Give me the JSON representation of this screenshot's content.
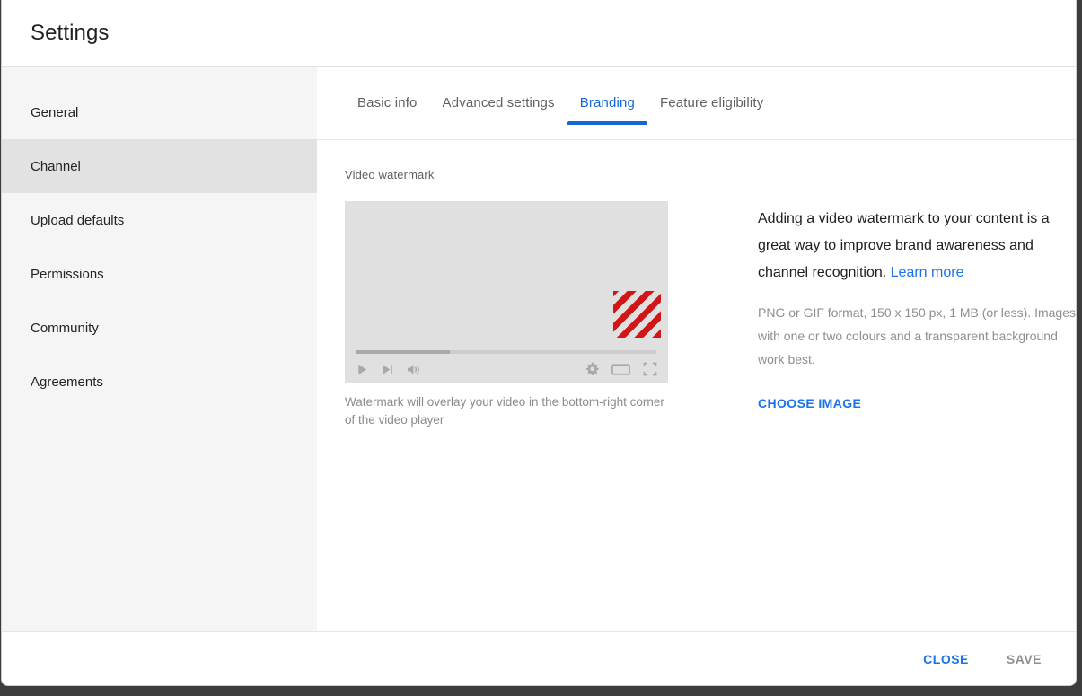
{
  "dialog": {
    "title": "Settings"
  },
  "sidebar": {
    "items": [
      {
        "label": "General",
        "selected": false
      },
      {
        "label": "Channel",
        "selected": true
      },
      {
        "label": "Upload defaults",
        "selected": false
      },
      {
        "label": "Permissions",
        "selected": false
      },
      {
        "label": "Community",
        "selected": false
      },
      {
        "label": "Agreements",
        "selected": false
      }
    ]
  },
  "tabs": [
    {
      "label": "Basic info",
      "active": false
    },
    {
      "label": "Advanced settings",
      "active": false
    },
    {
      "label": "Branding",
      "active": true
    },
    {
      "label": "Feature eligibility",
      "active": false
    }
  ],
  "panel": {
    "section_label": "Video watermark",
    "preview": {
      "caption": "Watermark will overlay your video in the bottom-right corner of the video player",
      "progress_percent": 31,
      "controls_left": [
        "play-icon",
        "next-track-icon",
        "volume-icon"
      ],
      "controls_right": [
        "gear-icon",
        "theater-mode-icon",
        "fullscreen-icon"
      ],
      "watermark_placeholder": "diagonal-stripes-red"
    },
    "description": {
      "main_text": "Adding a video watermark to your content is a great way to improve brand awareness and channel recognition. ",
      "learn_more_label": "Learn more",
      "sub_text": "PNG or GIF format, 150 x 150 px, 1 MB (or less). Images with one or two colours and a transparent background work best.",
      "choose_image_label": "CHOOSE IMAGE"
    }
  },
  "footer": {
    "close_label": "CLOSE",
    "save_label": "SAVE"
  },
  "colors": {
    "accent_blue": "#1a73e8",
    "tab_active_blue": "#1565d8",
    "watermark_red": "#d01616",
    "sidebar_bg": "#f5f5f5",
    "sidebar_selected_bg": "#e2e2e2",
    "video_bg": "#e0e0e0"
  }
}
